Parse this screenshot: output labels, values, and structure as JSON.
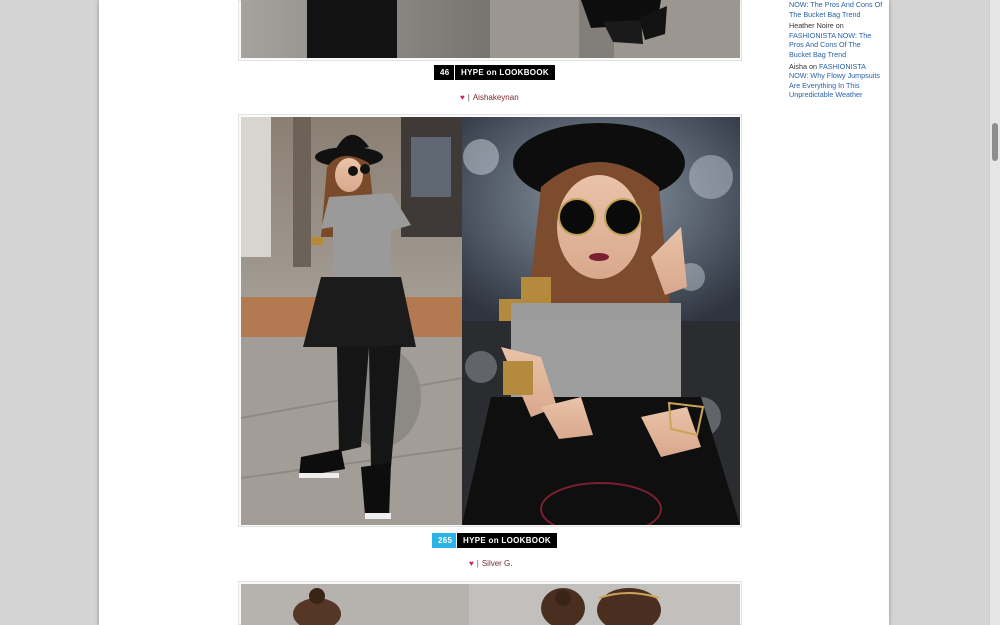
{
  "sidebar": {
    "comments": [
      {
        "author": "",
        "on": "",
        "link": "NOW: The Pros And Cons Of The Bucket Bag Trend"
      },
      {
        "author": "Heather Noire",
        "on": "on",
        "link": "FASHIONISTA NOW: The Pros And Cons Of The Bucket Bag Trend"
      },
      {
        "author": "Aisha",
        "on": "on",
        "link": "FASHIONISTA NOW: Why Flowy Jumpsuits Are Everything In This Unpredictable Weather"
      }
    ]
  },
  "posts": [
    {
      "hype_count": "46",
      "hype_label": "HYPE on LOOKBOOK",
      "heart": "♥",
      "separator": "|",
      "author": "Aishakeynan"
    },
    {
      "hype_count": "265",
      "hype_label": "HYPE on LOOKBOOK",
      "heart": "♥",
      "separator": "|",
      "author": "Silver G."
    }
  ],
  "colors": {
    "hype_blue": "#2ab3e6",
    "link_blue": "#2a62a8",
    "heart_pink": "#d0234f"
  }
}
